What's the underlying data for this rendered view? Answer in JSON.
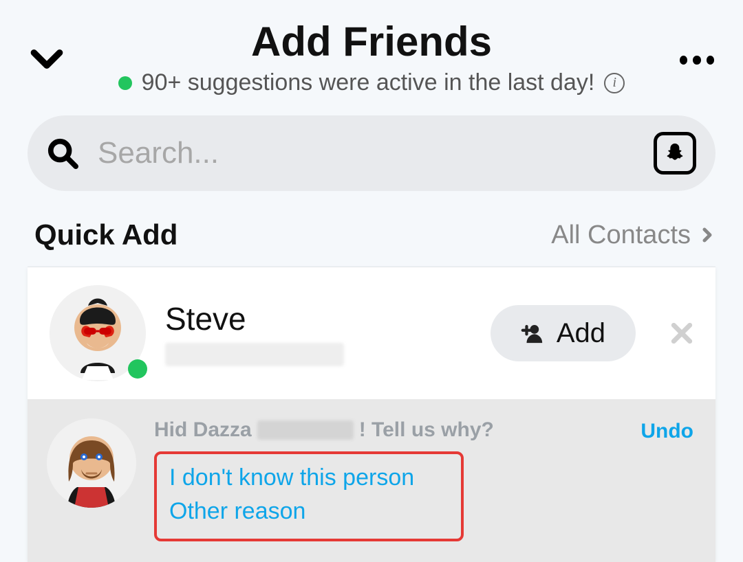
{
  "header": {
    "title": "Add Friends",
    "subline": "90+ suggestions were active in the last day!"
  },
  "search": {
    "placeholder": "Search..."
  },
  "section": {
    "title": "Quick Add",
    "link": "All Contacts"
  },
  "friend": {
    "name": "Steve",
    "add_label": "Add"
  },
  "hidden": {
    "prefix": "Hid Dazza",
    "suffix": "! Tell us why?",
    "undo": "Undo",
    "reason1": "I don't know this person",
    "reason2": "Other reason"
  }
}
